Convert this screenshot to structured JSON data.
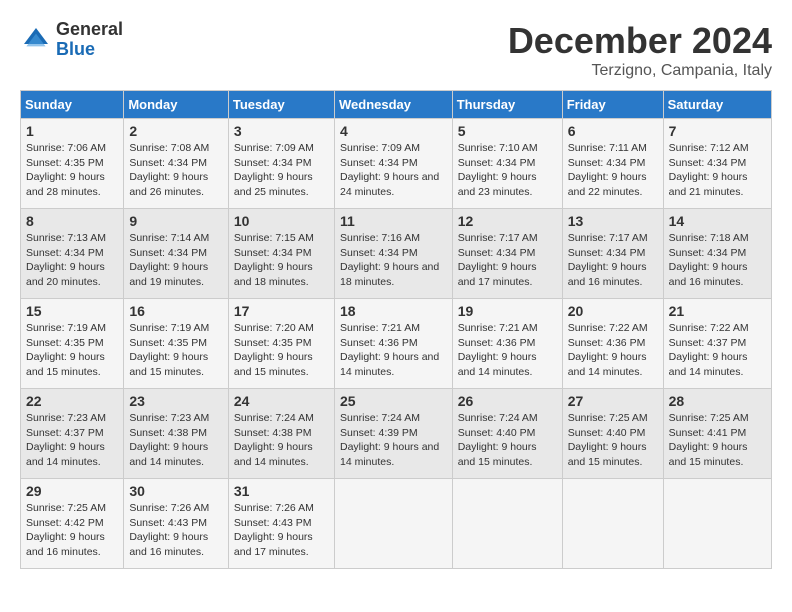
{
  "logo": {
    "text_general": "General",
    "text_blue": "Blue"
  },
  "title": "December 2024",
  "location": "Terzigno, Campania, Italy",
  "weekdays": [
    "Sunday",
    "Monday",
    "Tuesday",
    "Wednesday",
    "Thursday",
    "Friday",
    "Saturday"
  ],
  "weeks": [
    [
      {
        "day": "1",
        "sunrise": "7:06 AM",
        "sunset": "4:35 PM",
        "daylight": "9 hours and 28 minutes."
      },
      {
        "day": "2",
        "sunrise": "7:08 AM",
        "sunset": "4:34 PM",
        "daylight": "9 hours and 26 minutes."
      },
      {
        "day": "3",
        "sunrise": "7:09 AM",
        "sunset": "4:34 PM",
        "daylight": "9 hours and 25 minutes."
      },
      {
        "day": "4",
        "sunrise": "7:09 AM",
        "sunset": "4:34 PM",
        "daylight": "9 hours and 24 minutes."
      },
      {
        "day": "5",
        "sunrise": "7:10 AM",
        "sunset": "4:34 PM",
        "daylight": "9 hours and 23 minutes."
      },
      {
        "day": "6",
        "sunrise": "7:11 AM",
        "sunset": "4:34 PM",
        "daylight": "9 hours and 22 minutes."
      },
      {
        "day": "7",
        "sunrise": "7:12 AM",
        "sunset": "4:34 PM",
        "daylight": "9 hours and 21 minutes."
      }
    ],
    [
      {
        "day": "8",
        "sunrise": "7:13 AM",
        "sunset": "4:34 PM",
        "daylight": "9 hours and 20 minutes."
      },
      {
        "day": "9",
        "sunrise": "7:14 AM",
        "sunset": "4:34 PM",
        "daylight": "9 hours and 19 minutes."
      },
      {
        "day": "10",
        "sunrise": "7:15 AM",
        "sunset": "4:34 PM",
        "daylight": "9 hours and 18 minutes."
      },
      {
        "day": "11",
        "sunrise": "7:16 AM",
        "sunset": "4:34 PM",
        "daylight": "9 hours and 18 minutes."
      },
      {
        "day": "12",
        "sunrise": "7:17 AM",
        "sunset": "4:34 PM",
        "daylight": "9 hours and 17 minutes."
      },
      {
        "day": "13",
        "sunrise": "7:17 AM",
        "sunset": "4:34 PM",
        "daylight": "9 hours and 16 minutes."
      },
      {
        "day": "14",
        "sunrise": "7:18 AM",
        "sunset": "4:34 PM",
        "daylight": "9 hours and 16 minutes."
      }
    ],
    [
      {
        "day": "15",
        "sunrise": "7:19 AM",
        "sunset": "4:35 PM",
        "daylight": "9 hours and 15 minutes."
      },
      {
        "day": "16",
        "sunrise": "7:19 AM",
        "sunset": "4:35 PM",
        "daylight": "9 hours and 15 minutes."
      },
      {
        "day": "17",
        "sunrise": "7:20 AM",
        "sunset": "4:35 PM",
        "daylight": "9 hours and 15 minutes."
      },
      {
        "day": "18",
        "sunrise": "7:21 AM",
        "sunset": "4:36 PM",
        "daylight": "9 hours and 14 minutes."
      },
      {
        "day": "19",
        "sunrise": "7:21 AM",
        "sunset": "4:36 PM",
        "daylight": "9 hours and 14 minutes."
      },
      {
        "day": "20",
        "sunrise": "7:22 AM",
        "sunset": "4:36 PM",
        "daylight": "9 hours and 14 minutes."
      },
      {
        "day": "21",
        "sunrise": "7:22 AM",
        "sunset": "4:37 PM",
        "daylight": "9 hours and 14 minutes."
      }
    ],
    [
      {
        "day": "22",
        "sunrise": "7:23 AM",
        "sunset": "4:37 PM",
        "daylight": "9 hours and 14 minutes."
      },
      {
        "day": "23",
        "sunrise": "7:23 AM",
        "sunset": "4:38 PM",
        "daylight": "9 hours and 14 minutes."
      },
      {
        "day": "24",
        "sunrise": "7:24 AM",
        "sunset": "4:38 PM",
        "daylight": "9 hours and 14 minutes."
      },
      {
        "day": "25",
        "sunrise": "7:24 AM",
        "sunset": "4:39 PM",
        "daylight": "9 hours and 14 minutes."
      },
      {
        "day": "26",
        "sunrise": "7:24 AM",
        "sunset": "4:40 PM",
        "daylight": "9 hours and 15 minutes."
      },
      {
        "day": "27",
        "sunrise": "7:25 AM",
        "sunset": "4:40 PM",
        "daylight": "9 hours and 15 minutes."
      },
      {
        "day": "28",
        "sunrise": "7:25 AM",
        "sunset": "4:41 PM",
        "daylight": "9 hours and 15 minutes."
      }
    ],
    [
      {
        "day": "29",
        "sunrise": "7:25 AM",
        "sunset": "4:42 PM",
        "daylight": "9 hours and 16 minutes."
      },
      {
        "day": "30",
        "sunrise": "7:26 AM",
        "sunset": "4:43 PM",
        "daylight": "9 hours and 16 minutes."
      },
      {
        "day": "31",
        "sunrise": "7:26 AM",
        "sunset": "4:43 PM",
        "daylight": "9 hours and 17 minutes."
      },
      null,
      null,
      null,
      null
    ]
  ]
}
